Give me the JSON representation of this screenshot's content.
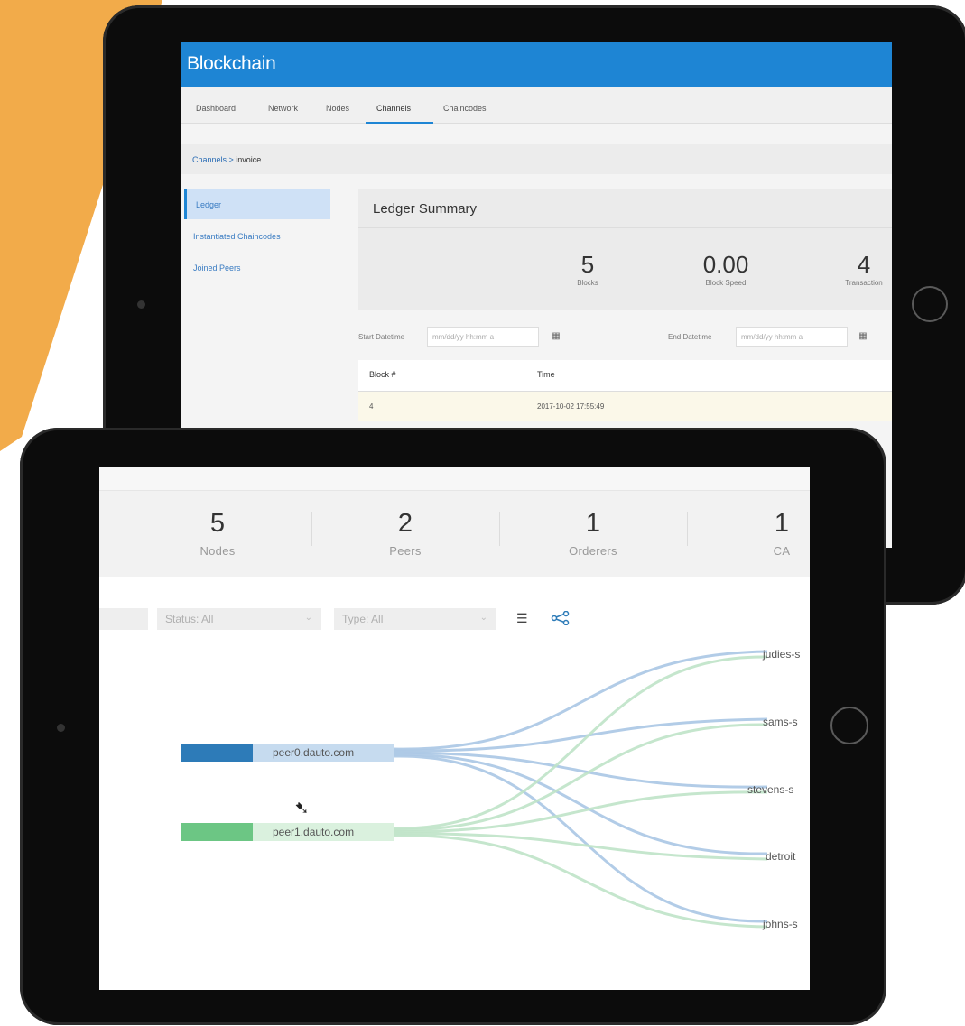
{
  "back_app": {
    "title": "Blockchain",
    "tabs": [
      "Dashboard",
      "Network",
      "Nodes",
      "Channels",
      "Chaincodes"
    ],
    "active_tab": "Channels",
    "breadcrumb": {
      "parent": "Channels",
      "sep": " > ",
      "current": "invoice"
    },
    "sidebar": [
      "Ledger",
      "Instantiated Chaincodes",
      "Joined Peers"
    ],
    "ledger_title": "Ledger Summary",
    "stats": [
      {
        "value": "5",
        "label": "Blocks"
      },
      {
        "value": "0.00",
        "label": "Block Speed"
      },
      {
        "value": "4",
        "label": "Transaction"
      }
    ],
    "start_label": "Start Datetime",
    "start_placeholder": "mm/dd/yy hh:mm a",
    "end_label": "End Datetime",
    "end_placeholder": "mm/dd/yy hh:mm a",
    "table_headers": [
      "Block #",
      "Time"
    ],
    "table_rows": [
      [
        "4",
        "2017-10-02 17:55:49"
      ]
    ]
  },
  "front_app": {
    "stats": [
      {
        "value": "5",
        "label": "Nodes"
      },
      {
        "value": "2",
        "label": "Peers"
      },
      {
        "value": "1",
        "label": "Orderers"
      },
      {
        "value": "1",
        "label": "CA"
      }
    ],
    "status_filter": "Status: All",
    "type_filter": "Type: All",
    "peers": [
      "peer0.dauto.com",
      "peer1.dauto.com"
    ],
    "targets": [
      "judies-s",
      "sams-s",
      "stevens-s",
      "detroit",
      "johns-s"
    ]
  },
  "colors": {
    "orange": "#f2ab4a",
    "header_blue": "#1e85d4",
    "peer0": "#2d7bb8",
    "peer1": "#6cc684",
    "link_blue": "#aac7e4",
    "link_green": "#bfe3c8"
  }
}
